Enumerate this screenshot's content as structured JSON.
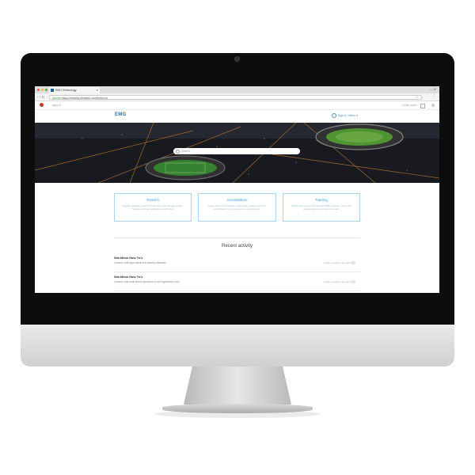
{
  "browser": {
    "tab_title": "EMG Technology",
    "tab_close": "×",
    "window_controls": "— ✕",
    "nav_arrows": "‹ › ↻",
    "secure_label": "Secure",
    "url": "https://motorfy.zendesk.com/hc/en-us",
    "star": "☆",
    "menu": "⋮"
  },
  "app_header": {
    "dropdown": "Apps ▾",
    "right_text": "Guide admin"
  },
  "page": {
    "logo": "EMG",
    "sign_in": "Sign in / Menu ▾"
  },
  "search": {
    "placeholder": "Search"
  },
  "cards": [
    {
      "title": "Rosters",
      "desc": "Register athletes, search for athletes and manage rosters. Tracking athletes registrations and roles."
    },
    {
      "title": "Accreditation",
      "desc": "Learn about Accreditation to generate, design and print accreditation for your events in a simple way."
    },
    {
      "title": "Training",
      "desc": "Online training and tutorials for EMG products. Video and guided sessions to learn the tools."
    }
  ],
  "recent": {
    "heading": "Recent activity",
    "items": [
      {
        "title": "Workflow How To's",
        "desc": "I want to add apps inside the training database",
        "meta_prefix": "Article created 1 day ago",
        "meta_count": "0 💬"
      },
      {
        "title": "Workflow How To's",
        "desc": "I want to add multi-select questions to the registration form",
        "meta_prefix": "Article created 1 day ago",
        "meta_count": "2 💬"
      }
    ]
  },
  "colors": {
    "accent": "#3a9fd4",
    "bezel": "#0d0d0d",
    "logo": "#2e6e9e"
  }
}
